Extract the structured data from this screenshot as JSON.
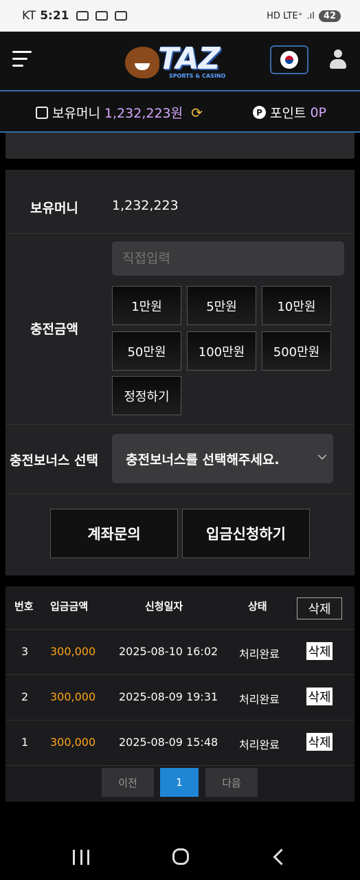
{
  "statusbar": {
    "carrier": "KT",
    "time": "5:21",
    "network": "HD LTE⁺",
    "battery": "42"
  },
  "header": {
    "logo_text": "TAZ",
    "logo_sub": "SPORTS & CASINO"
  },
  "balancebar": {
    "money_label": "보유머니",
    "money_value": "1,232,223원",
    "point_label": "포인트",
    "point_value": "0P"
  },
  "form": {
    "money_label": "보유머니",
    "money_value": "1,232,223",
    "amount_label": "충전금액",
    "amount_placeholder": "직접입력",
    "amount_buttons": [
      "1만원",
      "5만원",
      "10만원",
      "50만원",
      "100만원",
      "500만원",
      "정정하기"
    ],
    "bonus_label": "충전보너스 선택",
    "bonus_select_value": "충전보너스를 선택해주세요.",
    "account_inquiry_label": "계좌문의",
    "deposit_request_label": "입금신청하기"
  },
  "table": {
    "headers": {
      "no": "번호",
      "amount": "입금금액",
      "date": "신청일자",
      "status": "상태",
      "delete": "삭제"
    },
    "rows": [
      {
        "no": "3",
        "amount": "300,000",
        "date": "2025-08-10 16:02",
        "status": "처리완료",
        "delete": "삭제"
      },
      {
        "no": "2",
        "amount": "300,000",
        "date": "2025-08-09 19:31",
        "status": "처리완료",
        "delete": "삭제"
      },
      {
        "no": "1",
        "amount": "300,000",
        "date": "2025-08-09 15:48",
        "status": "처리완료",
        "delete": "삭제"
      }
    ],
    "pager": {
      "prev": "이전",
      "current": "1",
      "next": "다음"
    }
  },
  "colors": {
    "accent_blue": "#3a6ba8",
    "amount_orange": "#ffa31a",
    "balance_purple": "#d6a8ff",
    "page_active": "#1f86d6"
  }
}
